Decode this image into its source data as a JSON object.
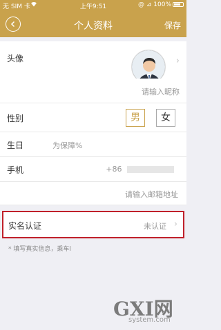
{
  "status_bar": {
    "carrier": "无 SIM 卡",
    "wifi_icon": "wifi-icon",
    "time": "上午9:51",
    "right": "@ ⊿ 100%"
  },
  "nav": {
    "title": "个人资料",
    "save_label": "保存"
  },
  "profile": {
    "avatar_label": "头像",
    "nickname_placeholder": "请输入昵称",
    "gender_label": "性别",
    "gender_options": [
      "男",
      "女"
    ],
    "gender_selected": "男",
    "birthday_label": "生日",
    "birthday_hint": "为保障%",
    "phone_label": "手机",
    "phone_prefix": "+86",
    "email_placeholder": "请输入邮箱地址"
  },
  "verification": {
    "label": "实名认证",
    "status": "未认证"
  },
  "hint": "* 填写真实信息，乘车l",
  "watermark": {
    "logo": "GXI网",
    "site": "system.com"
  },
  "colors": {
    "brand": "#c9a24c",
    "highlight": "#c0202a"
  }
}
